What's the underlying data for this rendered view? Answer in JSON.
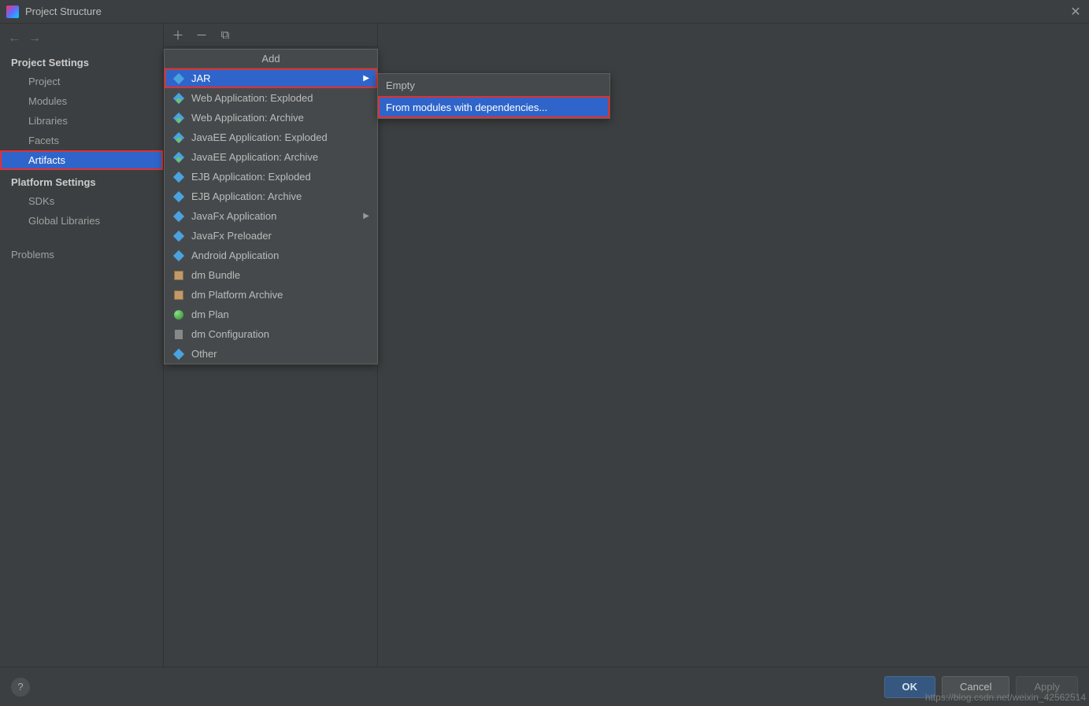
{
  "window": {
    "title": "Project Structure"
  },
  "sidebar": {
    "project_settings_header": "Project Settings",
    "platform_settings_header": "Platform Settings",
    "project_items": [
      "Project",
      "Modules",
      "Libraries",
      "Facets",
      "Artifacts"
    ],
    "platform_items": [
      "SDKs",
      "Global Libraries"
    ],
    "problems_label": "Problems",
    "selected": "Artifacts"
  },
  "add_menu": {
    "title": "Add",
    "items": [
      {
        "label": "JAR",
        "submenu": true,
        "icon": "diamond",
        "selected": true
      },
      {
        "label": "Web Application: Exploded",
        "submenu": false,
        "icon": "diamond-globe"
      },
      {
        "label": "Web Application: Archive",
        "submenu": false,
        "icon": "diamond-globe"
      },
      {
        "label": "JavaEE Application: Exploded",
        "submenu": false,
        "icon": "diamond-globe"
      },
      {
        "label": "JavaEE Application: Archive",
        "submenu": false,
        "icon": "diamond-globe"
      },
      {
        "label": "EJB Application: Exploded",
        "submenu": false,
        "icon": "diamond"
      },
      {
        "label": "EJB Application: Archive",
        "submenu": false,
        "icon": "diamond"
      },
      {
        "label": "JavaFx Application",
        "submenu": true,
        "icon": "diamond"
      },
      {
        "label": "JavaFx Preloader",
        "submenu": false,
        "icon": "diamond"
      },
      {
        "label": "Android Application",
        "submenu": false,
        "icon": "diamond"
      },
      {
        "label": "dm Bundle",
        "submenu": false,
        "icon": "box"
      },
      {
        "label": "dm Platform Archive",
        "submenu": false,
        "icon": "box"
      },
      {
        "label": "dm Plan",
        "submenu": false,
        "icon": "ball"
      },
      {
        "label": "dm Configuration",
        "submenu": false,
        "icon": "file"
      },
      {
        "label": "Other",
        "submenu": false,
        "icon": "diamond"
      }
    ]
  },
  "jar_submenu": {
    "items": [
      {
        "label": "Empty",
        "selected": false
      },
      {
        "label": "From modules with dependencies...",
        "selected": true
      }
    ]
  },
  "footer": {
    "ok": "OK",
    "cancel": "Cancel",
    "apply": "Apply",
    "help": "?"
  },
  "watermark": "https://blog.csdn.net/weixin_42562514"
}
